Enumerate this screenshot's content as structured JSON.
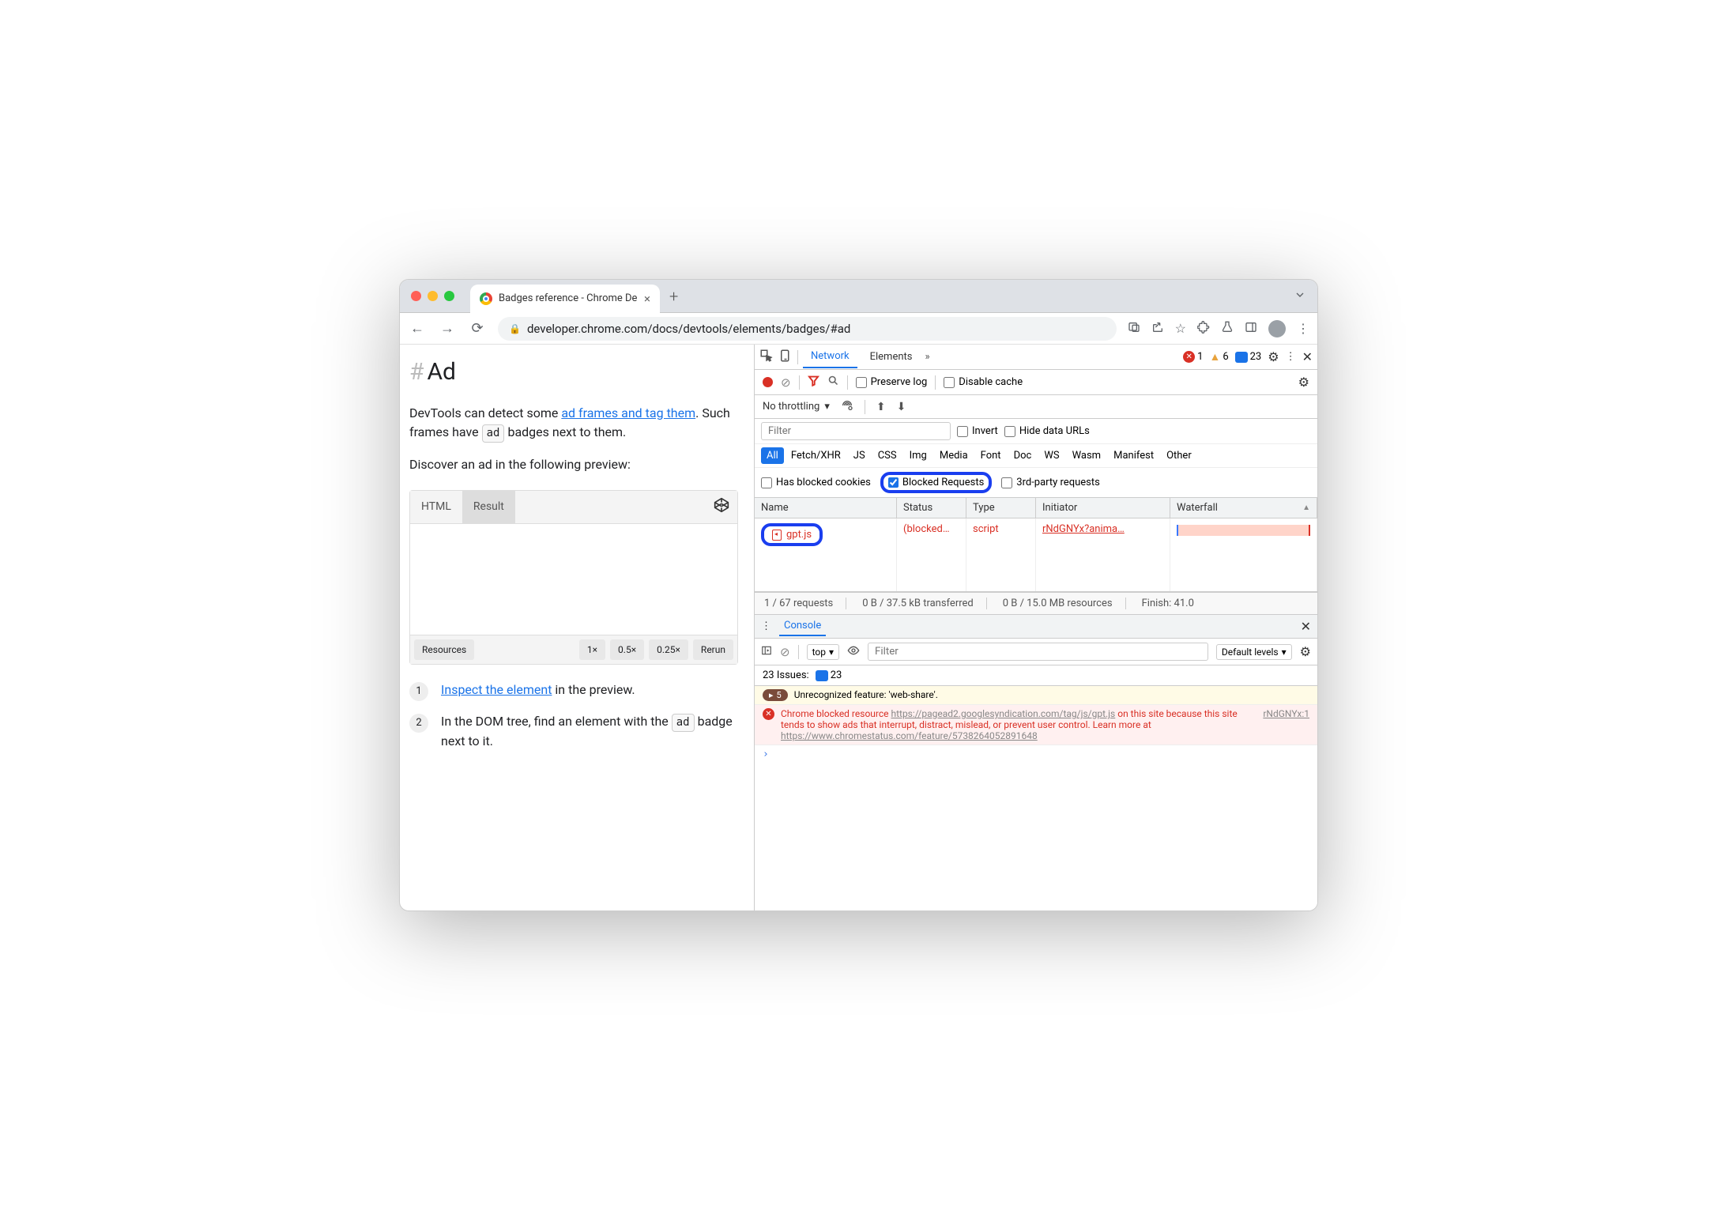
{
  "tab_title": "Badges reference - Chrome De",
  "url": "developer.chrome.com/docs/devtools/elements/badges/#ad",
  "content": {
    "heading": "Ad",
    "p1a": "DevTools can detect some ",
    "p1_link": "ad frames and tag them",
    "p1b": ". Such frames have ",
    "p1_badge": "ad",
    "p1c": " badges next to them.",
    "p2": "Discover an ad in the following preview:",
    "codepen": {
      "tab1": "HTML",
      "tab2": "Result",
      "foot1": "Resources",
      "f1": "1×",
      "f2": "0.5×",
      "f3": "0.25×",
      "f4": "Rerun"
    },
    "ol1_link": "Inspect the element",
    "ol1_rest": " in the preview.",
    "ol2a": "In the DOM tree, find an element with the ",
    "ol2_badge": "ad",
    "ol2b": " badge next to it."
  },
  "dt": {
    "tabs": {
      "network": "Network",
      "elements": "Elements"
    },
    "counts": {
      "errors": "1",
      "warnings": "6",
      "messages": "23"
    },
    "toolbar": {
      "preserve": "Preserve log",
      "disable": "Disable cache"
    },
    "throttling": "No throttling",
    "filter_placeholder": "Filter",
    "invert": "Invert",
    "hide_urls": "Hide data URLs",
    "types": [
      "All",
      "Fetch/XHR",
      "JS",
      "CSS",
      "Img",
      "Media",
      "Font",
      "Doc",
      "WS",
      "Wasm",
      "Manifest",
      "Other"
    ],
    "cb": {
      "blocked_cookies": "Has blocked cookies",
      "blocked_req": "Blocked Requests",
      "third": "3rd-party requests"
    },
    "cols": {
      "name": "Name",
      "status": "Status",
      "type": "Type",
      "initiator": "Initiator",
      "waterfall": "Waterfall"
    },
    "row": {
      "name": "gpt.js",
      "status": "(blocked…",
      "type": "script",
      "initiator": "rNdGNYx?anima…"
    },
    "status": {
      "req": "1 / 67 requests",
      "xfer": "0 B / 37.5 kB transferred",
      "res": "0 B / 15.0 MB resources",
      "finish": "Finish: 41.0"
    },
    "console": "Console",
    "ctx": "top",
    "levels": "Default levels",
    "issues_label": "23 Issues:",
    "issues_count": "23",
    "warn": {
      "count": "5",
      "text": "Unrecognized feature: 'web-share'."
    },
    "err": {
      "pre": "Chrome blocked resource ",
      "url": "https://pagead2.googlesyndication.com/tag/js/gpt.js",
      "mid": " on this site because this site tends to show ads that interrupt, distract, mislead, or prevent user control. Learn more at ",
      "url2": "https://www.chromestatus.com/feature/5738264052891648",
      "src": "rNdGNYx:1"
    }
  }
}
